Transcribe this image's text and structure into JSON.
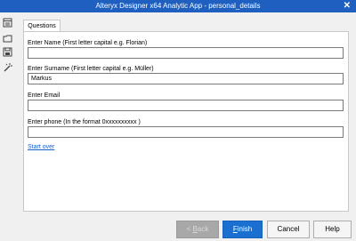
{
  "window": {
    "title": "Alteryx Designer x64 Analytic App - personal_details"
  },
  "sidebar": {
    "icons": [
      "app-icon",
      "folder-icon",
      "save-icon",
      "magic-wand-icon"
    ]
  },
  "tab": {
    "label": "Questions"
  },
  "form": {
    "fields": [
      {
        "label": "Enter Name (First letter capital e.g. Florian)",
        "value": ""
      },
      {
        "label": "Enter Surname (First letter capital e.g. Müller)",
        "value": "Markus"
      },
      {
        "label": "Enter Email",
        "value": ""
      },
      {
        "label": "Enter phone (In the format 0xxxxxxxxxx )",
        "value": ""
      }
    ],
    "start_over": "Start over"
  },
  "buttons": {
    "back_prefix": "< ",
    "back_key": "B",
    "back_rest": "ack",
    "finish_key": "F",
    "finish_rest": "inish",
    "cancel": "Cancel",
    "help": "Help"
  },
  "colors": {
    "titlebar": "#1e5fbf",
    "accent": "#1a6fd0",
    "link": "#1a5fc8"
  }
}
